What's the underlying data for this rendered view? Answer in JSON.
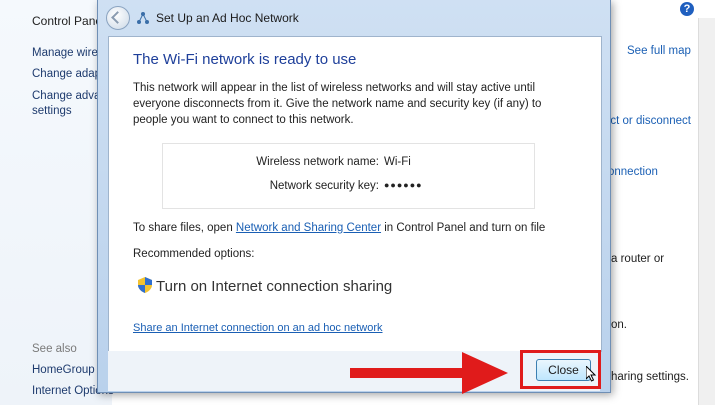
{
  "background": {
    "breadcrumb": "Control Panel",
    "left_links": [
      "Manage wirel",
      "Change adapt",
      "Change advar",
      "settings"
    ],
    "see_also_label": "See also",
    "see_also_links": [
      "HomeGroup",
      "Internet Options"
    ],
    "right_items": [
      {
        "text": "See full map",
        "kind": "link"
      },
      {
        "text": "ect or disconnect",
        "kind": "link"
      },
      {
        "text": "onnection",
        "kind": "link"
      },
      {
        "text": "a router or",
        "kind": "text"
      },
      {
        "text": "on.",
        "kind": "text"
      },
      {
        "text": "haring settings.",
        "kind": "text"
      }
    ],
    "help_symbol": "?"
  },
  "dialog": {
    "title": "Set Up an Ad Hoc Network",
    "heading": "The Wi-Fi network is ready to use",
    "description": "This network will appear in the list of wireless networks and will stay active until everyone disconnects from it. Give the network name and security key (if any) to people you want to connect to this network.",
    "network_name_label": "Wireless network name:",
    "network_name_value": "Wi-Fi",
    "security_key_label": "Network security key:",
    "security_key_value": "●●●●●●",
    "share_prefix": "To share files, open ",
    "share_link": "Network and Sharing Center",
    "share_suffix": " in Control Panel and turn on file",
    "recommended_label": "Recommended options:",
    "option_label": "Turn on Internet connection sharing",
    "bottom_link": "Share an Internet connection on an ad hoc network",
    "close_label": "Close"
  },
  "colors": {
    "accent_heading": "#1e3f9a",
    "link": "#1a5fb4",
    "annotation": "#e01b1b"
  },
  "icons": {
    "back": "back-arrow-icon",
    "network": "network-icon",
    "shield": "uac-shield-icon",
    "help": "help-icon",
    "cursor": "mouse-cursor-icon"
  }
}
